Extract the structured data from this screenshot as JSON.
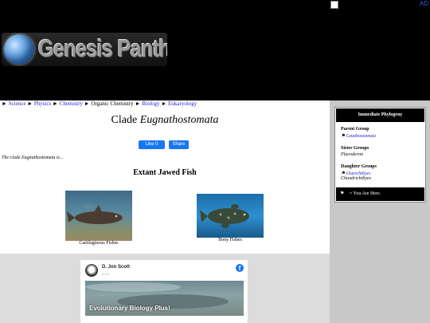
{
  "header": {
    "logo_text": "Genesis Panthesis",
    "side_ad_label": "AD"
  },
  "breadcrumb": [
    {
      "label": "Science",
      "link": true
    },
    {
      "label": "Physics",
      "link": true
    },
    {
      "label": "Chemistry",
      "link": true
    },
    {
      "label": "Organic Chemistry",
      "link": false
    },
    {
      "label": "Biology",
      "link": true
    },
    {
      "label": "Eukaryology",
      "link": true
    }
  ],
  "main": {
    "title_prefix": "Clade",
    "title_name": "Eugnathostomata",
    "fb_like_label": "Like 0",
    "fb_share_label": "Share",
    "intro": "The clade Eugnathostomata is...",
    "section_heading": "Extant Jawed Fish",
    "images": [
      {
        "caption": "Cartilaginous Fishes"
      },
      {
        "caption": "Bony Fishes"
      }
    ]
  },
  "phylogeny": {
    "heading": "Immediate Phylogeny",
    "parent_label": "Parent Group",
    "parent_value": "Gnathostomata",
    "sister_label": "Sister Groups",
    "sister_value": "Placodermi",
    "daughter_label": "Daughter Groups",
    "daughter_values": [
      "Osteichthyes",
      "Chondrichthyes"
    ],
    "footer": "= You Are Here.",
    "flag_glyph": "⚑"
  },
  "facebook_card": {
    "page_name": "D. Jon Scott",
    "page_sub": "1 0 0",
    "cover_text": "Evolutionary Biology Plus!",
    "icon": "f"
  },
  "colors": {
    "link": "#2222cc",
    "facebook": "#1877f2",
    "header_bg": "#000000",
    "sidebar_bg": "#c8c8c8",
    "footer_bg": "#dcdcdc"
  }
}
